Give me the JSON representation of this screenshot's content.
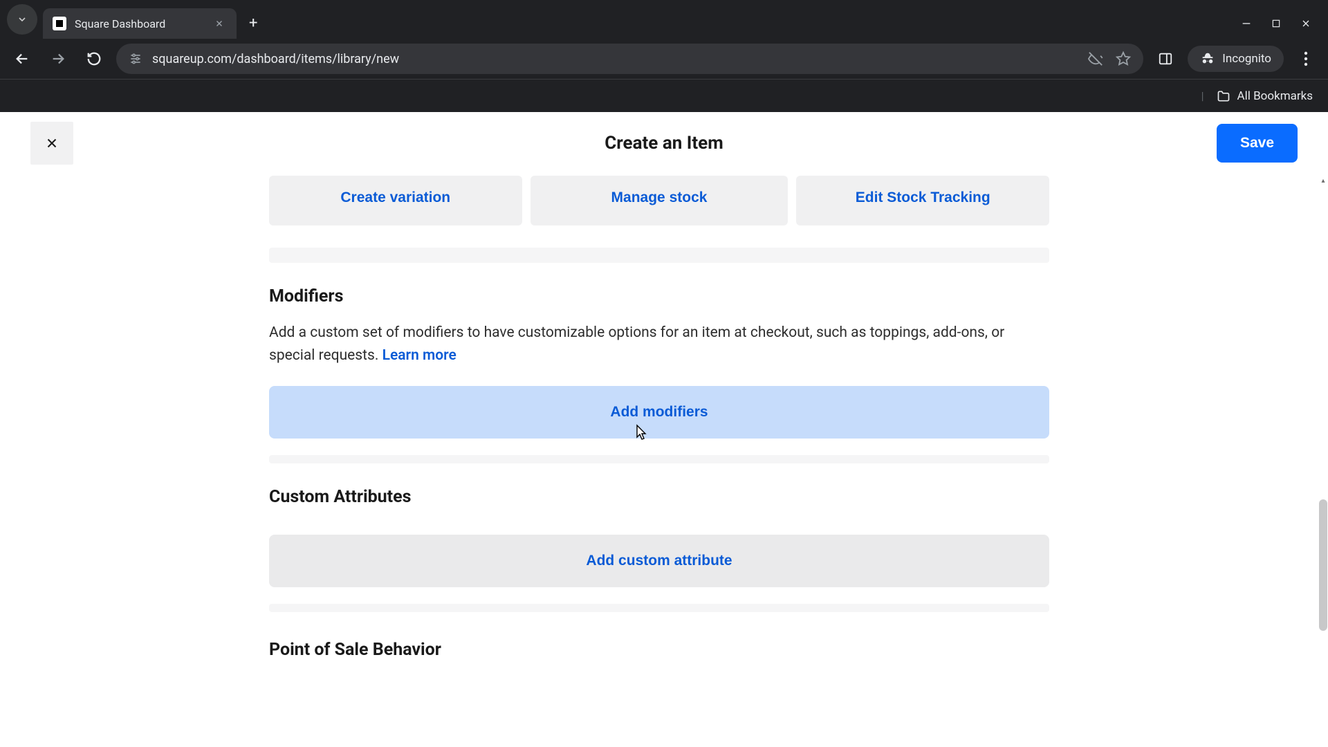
{
  "browser": {
    "tab_title": "Square Dashboard",
    "url": "squareup.com/dashboard/items/library/new",
    "incognito_label": "Incognito",
    "all_bookmarks": "All Bookmarks"
  },
  "header": {
    "title": "Create an Item",
    "save_label": "Save"
  },
  "actions": {
    "create_variation": "Create variation",
    "manage_stock": "Manage stock",
    "edit_stock_tracking": "Edit Stock Tracking"
  },
  "modifiers": {
    "heading": "Modifiers",
    "description": "Add a custom set of modifiers to have customizable options for an item at checkout, such as toppings, add-ons, or special requests. ",
    "learn_more": "Learn more",
    "button": "Add modifiers"
  },
  "custom_attributes": {
    "heading": "Custom Attributes",
    "button": "Add custom attribute"
  },
  "pos": {
    "heading": "Point of Sale Behavior"
  }
}
